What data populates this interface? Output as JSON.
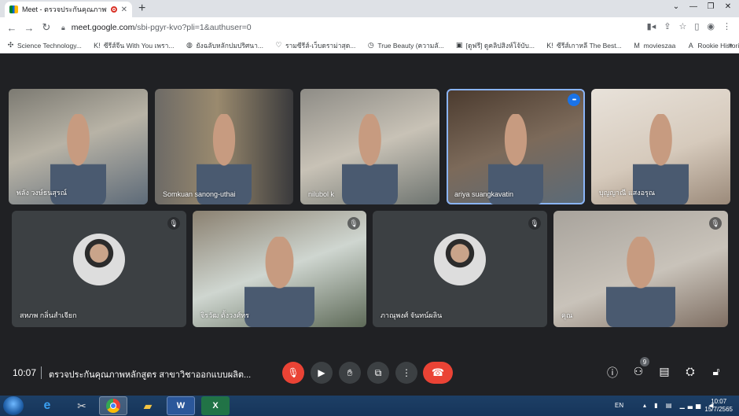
{
  "browser": {
    "tab_title": "Meet - ตรวจประกันคุณภาพหลัก",
    "new_tab": "+",
    "url_host": "meet.google.com",
    "url_rest": "/sbi-pgyr-kvo?pli=1&authuser=0",
    "bookmarks": [
      {
        "icon": "✣",
        "label": "Science Technology..."
      },
      {
        "icon": "K!",
        "label": "ซีรีส์จีน With You เพรา..."
      },
      {
        "icon": "◍",
        "label": "ยังฉลับหลักปมปริศนา..."
      },
      {
        "icon": "♡",
        "label": "รามซีรีส์-เว็บดราม่าสุด..."
      },
      {
        "icon": "◷",
        "label": "True Beauty (ความลั..."
      },
      {
        "icon": "▣",
        "label": "[ดูฟรี] ดูคลิปสิงห์โจ้บับ..."
      },
      {
        "icon": "K!",
        "label": "ซีรีส์เกาหลี The Best..."
      },
      {
        "icon": "M",
        "label": "movieszaa"
      },
      {
        "icon": "A",
        "label": "Rookie Historian G..."
      }
    ],
    "more": "»"
  },
  "participants": [
    {
      "name": "พลัง วงษ์ธนสุรณ์",
      "speaking": false,
      "muted": false
    },
    {
      "name": "Somkuan sanong-uthai",
      "speaking": false,
      "muted": false
    },
    {
      "name": "nilubol k",
      "speaking": false,
      "muted": false
    },
    {
      "name": "ariya suangkavatin",
      "speaking": true,
      "muted": false
    },
    {
      "name": "บุญญาณี แสงอรุณ",
      "speaking": false,
      "muted": false
    },
    {
      "name": "สหภพ กลิ่นสำเจียก",
      "speaking": false,
      "muted": true
    },
    {
      "name": "จิรวัฒ ตั้งวงศ์ทร",
      "speaking": false,
      "muted": true
    },
    {
      "name": "ภาณุพงศ์ จันทน์ผลิน",
      "speaking": false,
      "muted": true
    },
    {
      "name": "คุณ",
      "speaking": false,
      "muted": true
    }
  ],
  "bottom_bar": {
    "time": "10:07",
    "meeting_title": "ตรวจประกันคุณภาพหลักสูตร สาขาวิชาออกแบบผลิต...",
    "people_count": "9"
  },
  "taskbar": {
    "lang": "EN",
    "clock_time": "10:07",
    "clock_date": "15/7/2565",
    "apps": [
      "W",
      "X"
    ]
  },
  "colors": {
    "accent": "#8ab4f8",
    "danger": "#ea4335",
    "bg": "#202124",
    "tile": "#3c4043"
  }
}
